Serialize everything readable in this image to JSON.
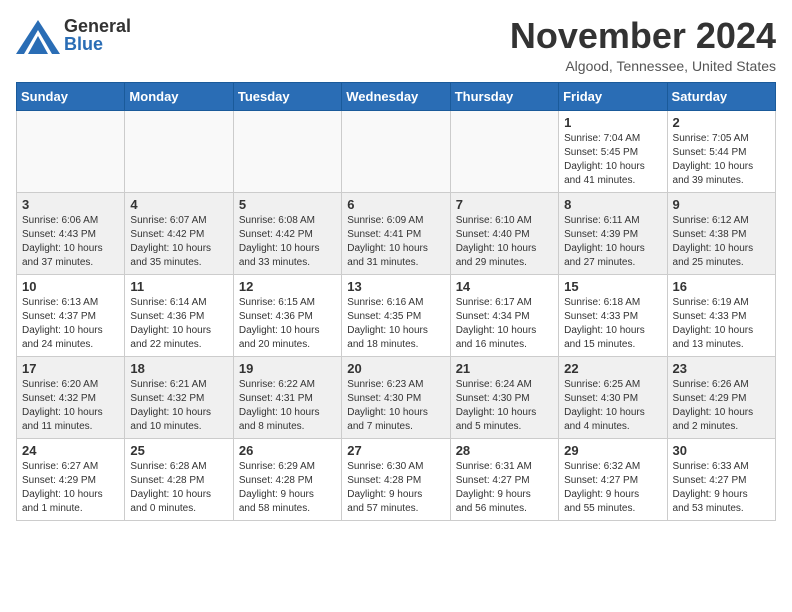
{
  "header": {
    "logo_general": "General",
    "logo_blue": "Blue",
    "month_title": "November 2024",
    "location": "Algood, Tennessee, United States"
  },
  "weekdays": [
    "Sunday",
    "Monday",
    "Tuesday",
    "Wednesday",
    "Thursday",
    "Friday",
    "Saturday"
  ],
  "weeks": [
    [
      {
        "day": "",
        "info": ""
      },
      {
        "day": "",
        "info": ""
      },
      {
        "day": "",
        "info": ""
      },
      {
        "day": "",
        "info": ""
      },
      {
        "day": "",
        "info": ""
      },
      {
        "day": "1",
        "info": "Sunrise: 7:04 AM\nSunset: 5:45 PM\nDaylight: 10 hours\nand 41 minutes."
      },
      {
        "day": "2",
        "info": "Sunrise: 7:05 AM\nSunset: 5:44 PM\nDaylight: 10 hours\nand 39 minutes."
      }
    ],
    [
      {
        "day": "3",
        "info": "Sunrise: 6:06 AM\nSunset: 4:43 PM\nDaylight: 10 hours\nand 37 minutes."
      },
      {
        "day": "4",
        "info": "Sunrise: 6:07 AM\nSunset: 4:42 PM\nDaylight: 10 hours\nand 35 minutes."
      },
      {
        "day": "5",
        "info": "Sunrise: 6:08 AM\nSunset: 4:42 PM\nDaylight: 10 hours\nand 33 minutes."
      },
      {
        "day": "6",
        "info": "Sunrise: 6:09 AM\nSunset: 4:41 PM\nDaylight: 10 hours\nand 31 minutes."
      },
      {
        "day": "7",
        "info": "Sunrise: 6:10 AM\nSunset: 4:40 PM\nDaylight: 10 hours\nand 29 minutes."
      },
      {
        "day": "8",
        "info": "Sunrise: 6:11 AM\nSunset: 4:39 PM\nDaylight: 10 hours\nand 27 minutes."
      },
      {
        "day": "9",
        "info": "Sunrise: 6:12 AM\nSunset: 4:38 PM\nDaylight: 10 hours\nand 25 minutes."
      }
    ],
    [
      {
        "day": "10",
        "info": "Sunrise: 6:13 AM\nSunset: 4:37 PM\nDaylight: 10 hours\nand 24 minutes."
      },
      {
        "day": "11",
        "info": "Sunrise: 6:14 AM\nSunset: 4:36 PM\nDaylight: 10 hours\nand 22 minutes."
      },
      {
        "day": "12",
        "info": "Sunrise: 6:15 AM\nSunset: 4:36 PM\nDaylight: 10 hours\nand 20 minutes."
      },
      {
        "day": "13",
        "info": "Sunrise: 6:16 AM\nSunset: 4:35 PM\nDaylight: 10 hours\nand 18 minutes."
      },
      {
        "day": "14",
        "info": "Sunrise: 6:17 AM\nSunset: 4:34 PM\nDaylight: 10 hours\nand 16 minutes."
      },
      {
        "day": "15",
        "info": "Sunrise: 6:18 AM\nSunset: 4:33 PM\nDaylight: 10 hours\nand 15 minutes."
      },
      {
        "day": "16",
        "info": "Sunrise: 6:19 AM\nSunset: 4:33 PM\nDaylight: 10 hours\nand 13 minutes."
      }
    ],
    [
      {
        "day": "17",
        "info": "Sunrise: 6:20 AM\nSunset: 4:32 PM\nDaylight: 10 hours\nand 11 minutes."
      },
      {
        "day": "18",
        "info": "Sunrise: 6:21 AM\nSunset: 4:32 PM\nDaylight: 10 hours\nand 10 minutes."
      },
      {
        "day": "19",
        "info": "Sunrise: 6:22 AM\nSunset: 4:31 PM\nDaylight: 10 hours\nand 8 minutes."
      },
      {
        "day": "20",
        "info": "Sunrise: 6:23 AM\nSunset: 4:30 PM\nDaylight: 10 hours\nand 7 minutes."
      },
      {
        "day": "21",
        "info": "Sunrise: 6:24 AM\nSunset: 4:30 PM\nDaylight: 10 hours\nand 5 minutes."
      },
      {
        "day": "22",
        "info": "Sunrise: 6:25 AM\nSunset: 4:30 PM\nDaylight: 10 hours\nand 4 minutes."
      },
      {
        "day": "23",
        "info": "Sunrise: 6:26 AM\nSunset: 4:29 PM\nDaylight: 10 hours\nand 2 minutes."
      }
    ],
    [
      {
        "day": "24",
        "info": "Sunrise: 6:27 AM\nSunset: 4:29 PM\nDaylight: 10 hours\nand 1 minute."
      },
      {
        "day": "25",
        "info": "Sunrise: 6:28 AM\nSunset: 4:28 PM\nDaylight: 10 hours\nand 0 minutes."
      },
      {
        "day": "26",
        "info": "Sunrise: 6:29 AM\nSunset: 4:28 PM\nDaylight: 9 hours\nand 58 minutes."
      },
      {
        "day": "27",
        "info": "Sunrise: 6:30 AM\nSunset: 4:28 PM\nDaylight: 9 hours\nand 57 minutes."
      },
      {
        "day": "28",
        "info": "Sunrise: 6:31 AM\nSunset: 4:27 PM\nDaylight: 9 hours\nand 56 minutes."
      },
      {
        "day": "29",
        "info": "Sunrise: 6:32 AM\nSunset: 4:27 PM\nDaylight: 9 hours\nand 55 minutes."
      },
      {
        "day": "30",
        "info": "Sunrise: 6:33 AM\nSunset: 4:27 PM\nDaylight: 9 hours\nand 53 minutes."
      }
    ]
  ]
}
